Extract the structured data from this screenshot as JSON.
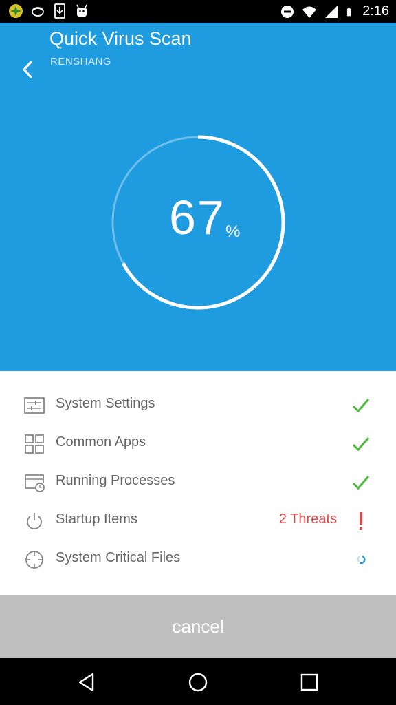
{
  "status_bar": {
    "time": "2:16",
    "left_icons": [
      "app-badge-icon",
      "pie-icon",
      "download-icon",
      "android-icon"
    ],
    "right_icons": [
      "do-not-disturb-icon",
      "wifi-icon",
      "signal-icon",
      "battery-icon"
    ]
  },
  "header": {
    "title": "Quick Virus Scan",
    "subtitle": "RENSHANG",
    "background": "#1f9be0"
  },
  "progress": {
    "value": "67",
    "unit": "%",
    "fraction": 0.67
  },
  "scan_items": [
    {
      "label": "System Settings",
      "icon": "settings-sliders-icon",
      "status": "done"
    },
    {
      "label": "Common Apps",
      "icon": "apps-grid-icon",
      "status": "done"
    },
    {
      "label": "Running Processes",
      "icon": "process-clock-icon",
      "status": "done"
    },
    {
      "label": "Startup Items",
      "icon": "power-icon",
      "status": "threat",
      "threat_text": "2 Threats"
    },
    {
      "label": "System Critical Files",
      "icon": "crosshair-icon",
      "status": "scanning"
    }
  ],
  "colors": {
    "check": "#4cbb3c",
    "threat": "#e64545",
    "spinner": "#1f9be0"
  },
  "cancel": {
    "label": "cancel"
  },
  "nav": {
    "buttons": [
      "back-triangle-icon",
      "home-circle-icon",
      "recents-square-icon"
    ]
  }
}
